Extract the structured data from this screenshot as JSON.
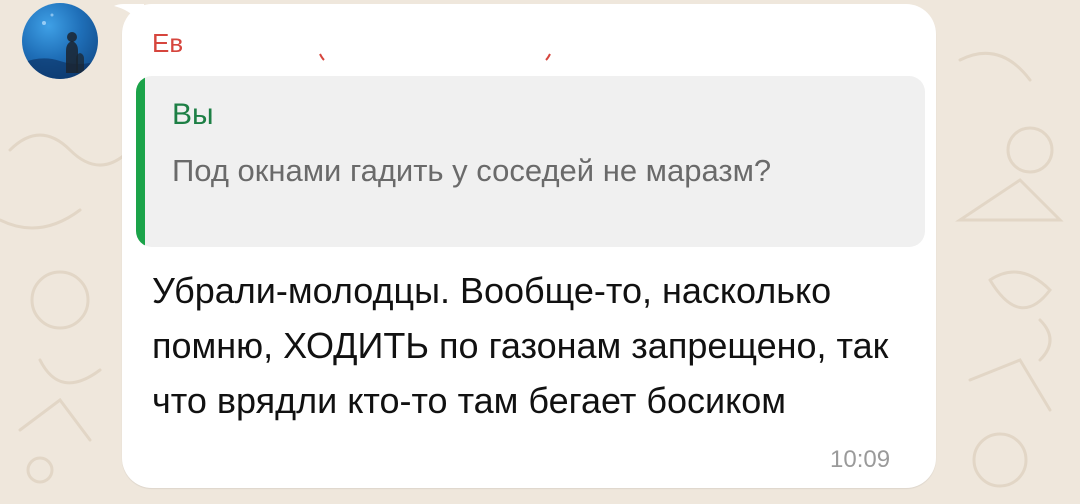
{
  "message": {
    "sender_name": "Ев",
    "quote": {
      "author": "Вы",
      "text": "Под окнами гадить у соседей не маразм?"
    },
    "text": "Убрали-молодцы. Вообще-то, насколько помню, ХОДИТЬ по газонам запрещено, так что врядли кто-то там бегает босиком",
    "time": "10:09"
  },
  "colors": {
    "chat_background": "#efe7dc",
    "bubble": "#ffffff",
    "sender_name": "#d6453d",
    "quote_accent": "#1ba349",
    "quote_author": "#1d7f45"
  },
  "icons": {
    "avatar": "ocean-profile-photo",
    "wallpaper": "doodle-pattern"
  }
}
